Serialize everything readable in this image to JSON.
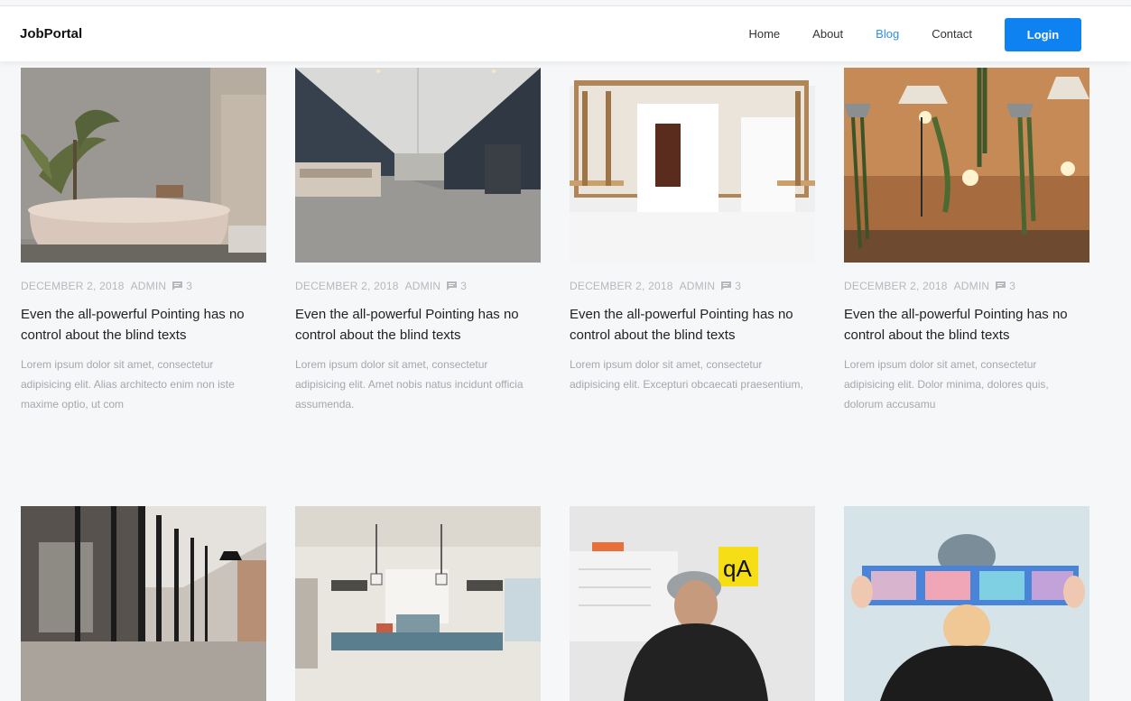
{
  "brand": "JobPortal",
  "nav": {
    "items": [
      "Home",
      "About",
      "Blog",
      "Contact"
    ],
    "active": "Blog",
    "login_label": "Login"
  },
  "colors": {
    "accent": "#0d82f0",
    "active_link": "#2f8ee5"
  },
  "posts": [
    {
      "image": "bathroom-bathtub-photo",
      "date": "DECEMBER 2, 2018",
      "author": "ADMIN",
      "comment_icon": "comment-icon",
      "comments": "3",
      "title": "Even the all-powerful Pointing has no control about the blind texts",
      "excerpt": "Lorem ipsum dolor sit amet, consectetur adipisicing elit. Alias architecto enim non iste maxime optio, ut com"
    },
    {
      "image": "office-corridor-photo",
      "date": "DECEMBER 2, 2018",
      "author": "ADMIN",
      "comment_icon": "comment-icon",
      "comments": "3",
      "title": "Even the all-powerful Pointing has no control about the blind texts",
      "excerpt": "Lorem ipsum dolor sit amet, consectetur adipisicing elit. Amet nobis natus incidunt officia assumenda."
    },
    {
      "image": "white-room-shelves-photo",
      "date": "DECEMBER 2, 2018",
      "author": "ADMIN",
      "comment_icon": "comment-icon",
      "comments": "3",
      "title": "Even the all-powerful Pointing has no control about the blind texts",
      "excerpt": "Lorem ipsum dolor sit amet, consectetur adipisicing elit. Excepturi obcaecati praesentium,"
    },
    {
      "image": "hanging-plants-lamps-photo",
      "date": "DECEMBER 2, 2018",
      "author": "ADMIN",
      "comment_icon": "comment-icon",
      "comments": "3",
      "title": "Even the all-powerful Pointing has no control about the blind texts",
      "excerpt": "Lorem ipsum dolor sit amet, consectetur adipisicing elit. Dolor minima, dolores quis, dolorum accusamu"
    },
    {
      "image": "glass-office-photo"
    },
    {
      "image": "kitchen-interior-photo"
    },
    {
      "image": "man-whiteboard-photo"
    },
    {
      "image": "woman-holding-prints-photo"
    }
  ]
}
